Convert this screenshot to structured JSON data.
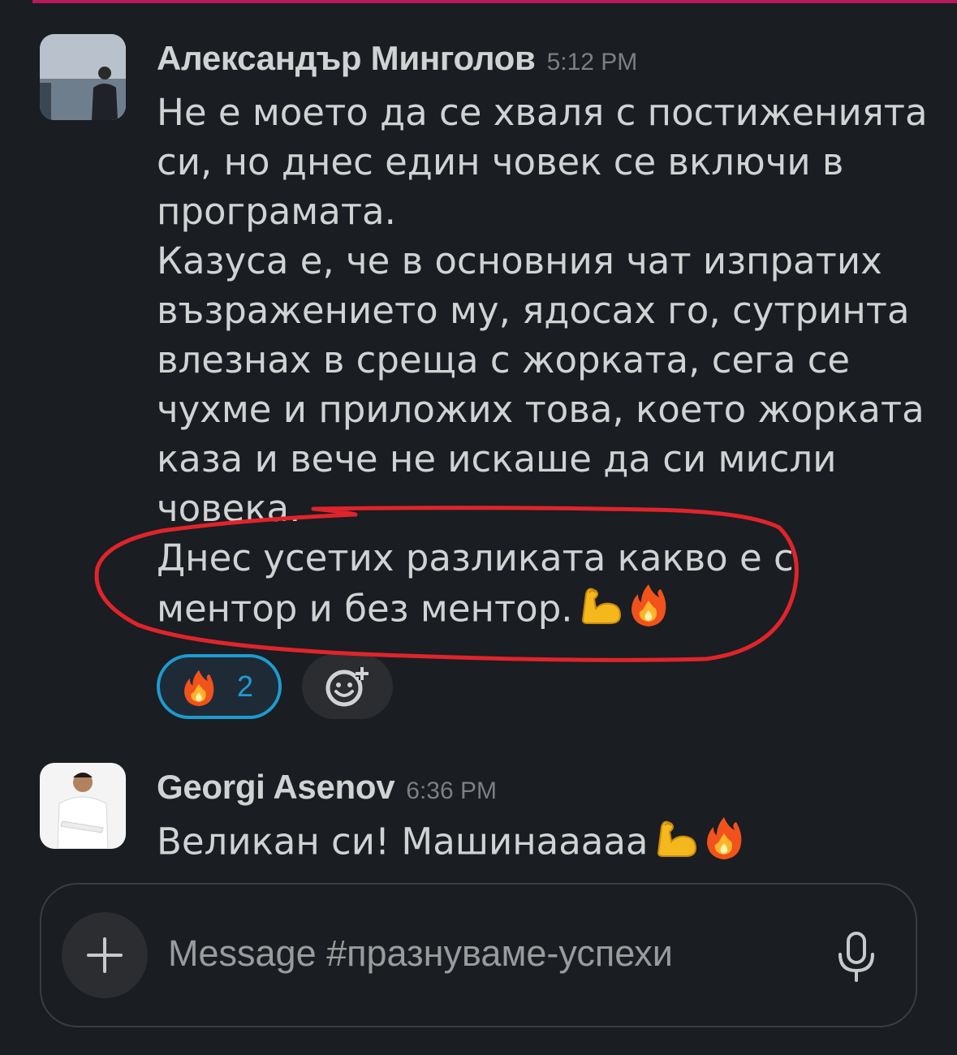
{
  "messages": [
    {
      "author": "Александър Минголов",
      "time": "5:12 PM",
      "lines": [
        "Не е моето да се хваля с постиженията",
        "си, но днес един човек се включи в",
        "програмата.",
        "Казуса е, че в основния чат изпратих",
        "възражението му, ядосах го, сутринта",
        "влезнах в среща с жорката, сега се",
        "чухме и приложих това, което жорката",
        "каза и вече не искаше да си мисли",
        "човека.",
        "Днес усетих разликата какво е с",
        "ментор и без ментор."
      ],
      "reactions": [
        {
          "emoji": "fire",
          "count": "2"
        }
      ]
    },
    {
      "author": "Georgi Asenov",
      "time": "6:36 PM",
      "lines": [
        "Великан си! Машинааааа"
      ]
    }
  ],
  "composer": {
    "placeholder": "Message #празнуваме-успехи"
  },
  "colors": {
    "background": "#1a1d21",
    "text": "#d1d2d3",
    "timestamp": "#7d7f82",
    "reaction_active_border": "#1d9bd1",
    "annotation_red": "#e0242c"
  }
}
